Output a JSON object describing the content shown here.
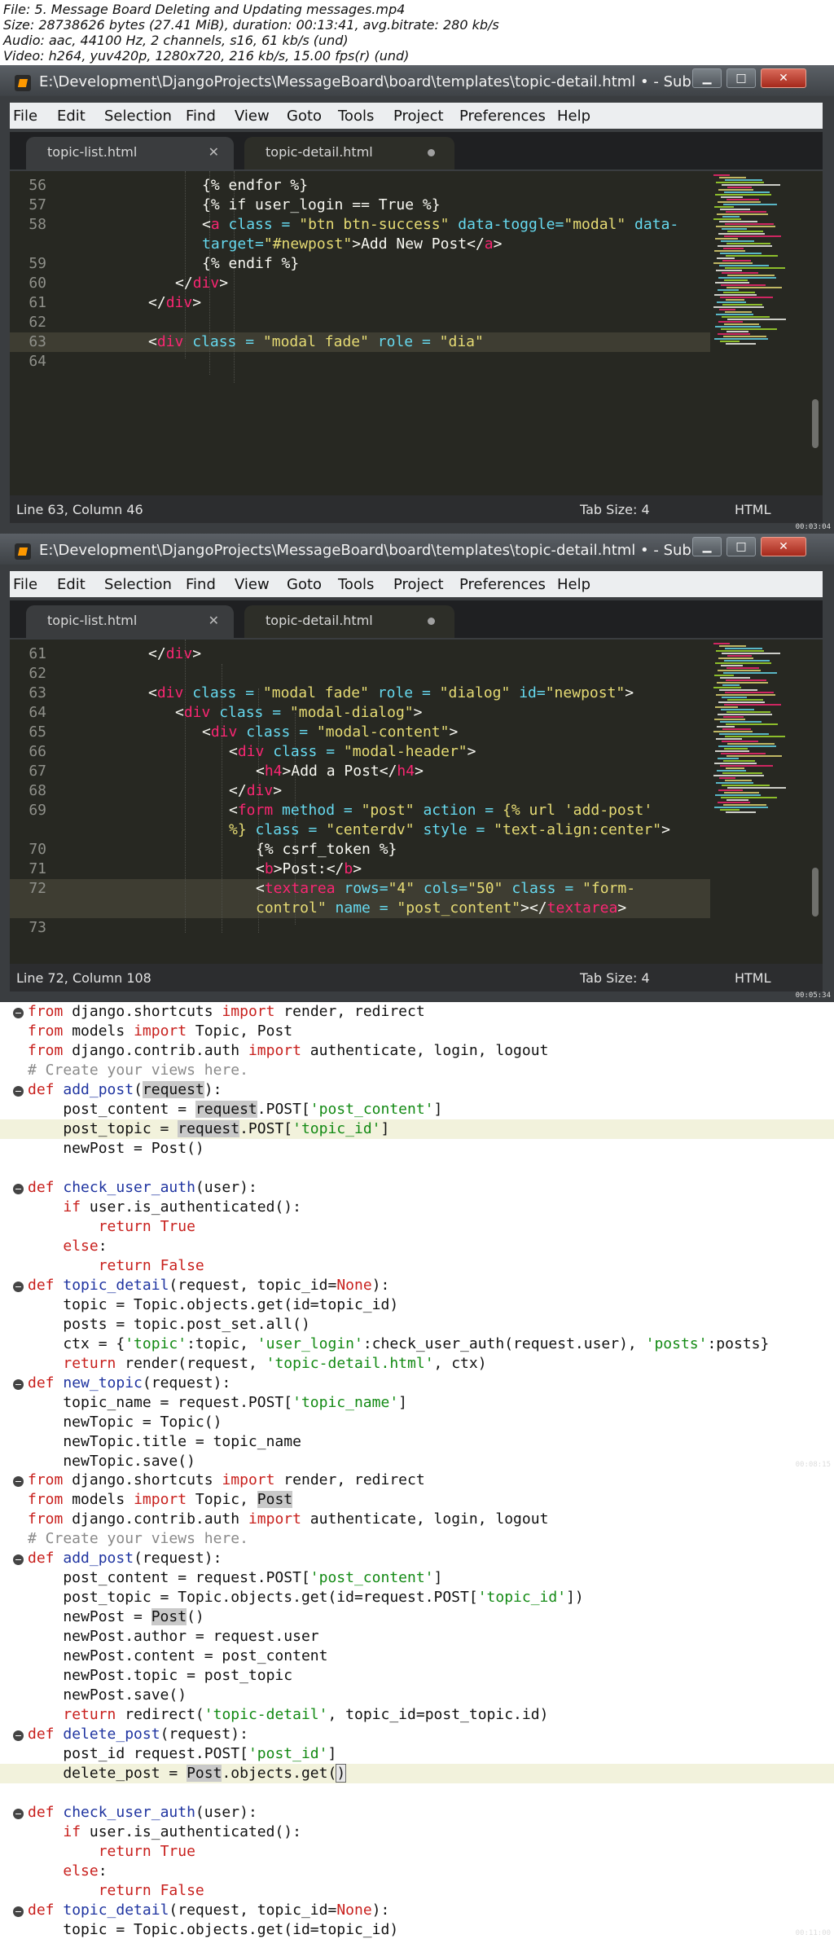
{
  "video_info": [
    "File: 5. Message Board Deleting and Updating messages.mp4",
    "Size: 28738626 bytes (27.41 MiB), duration: 00:13:41, avg.bitrate: 280 kb/s",
    "Audio: aac, 44100 Hz, 2 channels, s16, 61 kb/s (und)",
    "Video: h264, yuv420p, 1280x720, 216 kb/s, 15.00 fps(r) (und)"
  ],
  "colors": {
    "editor_bg": "#272822",
    "keyword": "#f92672",
    "string": "#e6db74",
    "text": "#f8f8f2",
    "py_keyword": "#c8201d",
    "py_function": "#1f34a0",
    "py_string": "#138a14",
    "py_comment": "#8a8a8a"
  },
  "frame1": {
    "title": "E:\\Development\\DjangoProjects\\MessageBoard\\board\\templates\\topic-detail.html • - Subli...",
    "menu": [
      "File",
      "Edit",
      "Selection",
      "Find",
      "View",
      "Goto",
      "Tools",
      "Project",
      "Preferences",
      "Help"
    ],
    "tabs": [
      "topic-list.html",
      "topic-detail.html"
    ],
    "status": {
      "position": "Line 63, Column 46",
      "tab_size": "Tab Size: 4",
      "syntax": "HTML"
    },
    "timestamp": "00:03:04",
    "gutter": [
      "56",
      "57",
      "58",
      "",
      "59",
      "60",
      "61",
      "62",
      "63",
      "64"
    ],
    "lines": [
      [
        [
          "{% endfor %}",
          "text"
        ]
      ],
      [
        [
          "{% if user_login == True %}",
          "text"
        ]
      ],
      [
        [
          "<",
          "text"
        ],
        [
          "a",
          "keyword"
        ],
        [
          " class = ",
          "func"
        ],
        [
          "\"btn btn-success\"",
          "string"
        ],
        [
          " data-toggle=",
          "func"
        ],
        [
          "\"modal\"",
          "string"
        ],
        [
          " data-",
          "func"
        ]
      ],
      [
        [
          "target=",
          "func"
        ],
        [
          "\"#newpost\"",
          "string"
        ],
        [
          ">Add New Post</",
          "text"
        ],
        [
          "a",
          "keyword"
        ],
        [
          ">",
          "text"
        ]
      ],
      [
        [
          "{% endif %}",
          "text"
        ]
      ],
      [
        [
          "</",
          "text"
        ],
        [
          "div",
          "keyword"
        ],
        [
          ">",
          "text"
        ]
      ],
      [
        [
          "</",
          "text"
        ],
        [
          "div",
          "keyword"
        ],
        [
          ">",
          "text"
        ]
      ],
      [
        [
          "",
          "text"
        ]
      ],
      [
        [
          "<",
          "text"
        ],
        [
          "div",
          "keyword"
        ],
        [
          " class = ",
          "func"
        ],
        [
          "\"modal fade\"",
          "string"
        ],
        [
          " role = ",
          "func"
        ],
        [
          "\"dia\"",
          "string"
        ]
      ],
      [
        [
          "",
          "text"
        ]
      ]
    ]
  },
  "frame2": {
    "title": "E:\\Development\\DjangoProjects\\MessageBoard\\board\\templates\\topic-detail.html • - Subli...",
    "menu": [
      "File",
      "Edit",
      "Selection",
      "Find",
      "View",
      "Goto",
      "Tools",
      "Project",
      "Preferences",
      "Help"
    ],
    "tabs": [
      "topic-list.html",
      "topic-detail.html"
    ],
    "status": {
      "position": "Line 72, Column 108",
      "tab_size": "Tab Size: 4",
      "syntax": "HTML"
    },
    "timestamp": "00:05:34",
    "gutter": [
      "61",
      "62",
      "63",
      "64",
      "65",
      "66",
      "67",
      "68",
      "69",
      "",
      "70",
      "71",
      "72",
      "",
      "73"
    ],
    "lines": [
      [
        [
          "</",
          "text"
        ],
        [
          "div",
          "keyword"
        ],
        [
          ">",
          "text"
        ]
      ],
      [
        [
          "",
          "text"
        ]
      ],
      [
        [
          "<",
          "text"
        ],
        [
          "div",
          "keyword"
        ],
        [
          " class = ",
          "func"
        ],
        [
          "\"modal fade\"",
          "string"
        ],
        [
          " role = ",
          "func"
        ],
        [
          "\"dialog\"",
          "string"
        ],
        [
          " id=",
          "func"
        ],
        [
          "\"newpost\"",
          "string"
        ],
        [
          ">",
          "text"
        ]
      ],
      [
        [
          "<",
          "text"
        ],
        [
          "div",
          "keyword"
        ],
        [
          " class = ",
          "func"
        ],
        [
          "\"modal-dialog\"",
          "string"
        ],
        [
          ">",
          "text"
        ]
      ],
      [
        [
          "<",
          "text"
        ],
        [
          "div",
          "keyword"
        ],
        [
          " class = ",
          "func"
        ],
        [
          "\"modal-content\"",
          "string"
        ],
        [
          ">",
          "text"
        ]
      ],
      [
        [
          "<",
          "text"
        ],
        [
          "div",
          "keyword"
        ],
        [
          " class = ",
          "func"
        ],
        [
          "\"modal-header\"",
          "string"
        ],
        [
          ">",
          "text"
        ]
      ],
      [
        [
          "<",
          "text"
        ],
        [
          "h4",
          "keyword"
        ],
        [
          ">Add a Post</",
          "text"
        ],
        [
          "h4",
          "keyword"
        ],
        [
          ">",
          "text"
        ]
      ],
      [
        [
          "</",
          "text"
        ],
        [
          "div",
          "keyword"
        ],
        [
          ">",
          "text"
        ]
      ],
      [
        [
          "<",
          "text"
        ],
        [
          "form",
          "keyword"
        ],
        [
          " method = ",
          "func"
        ],
        [
          "\"post\"",
          "string"
        ],
        [
          " action = ",
          "func"
        ],
        [
          "{% url 'add-post'",
          "string"
        ]
      ],
      [
        [
          "%}",
          "string"
        ],
        [
          " class = ",
          "func"
        ],
        [
          "\"centerdv\"",
          "string"
        ],
        [
          " style = ",
          "func"
        ],
        [
          "\"text-align:center\"",
          "string"
        ],
        [
          ">",
          "text"
        ]
      ],
      [
        [
          "{% csrf_token %}",
          "text"
        ]
      ],
      [
        [
          "<",
          "text"
        ],
        [
          "b",
          "keyword"
        ],
        [
          ">Post:</",
          "text"
        ],
        [
          "b",
          "keyword"
        ],
        [
          ">",
          "text"
        ]
      ],
      [
        [
          "<",
          "text"
        ],
        [
          "textarea",
          "keyword"
        ],
        [
          " rows=",
          "func"
        ],
        [
          "\"4\"",
          "string"
        ],
        [
          " cols=",
          "func"
        ],
        [
          "\"50\"",
          "string"
        ],
        [
          " class = ",
          "func"
        ],
        [
          "\"form-",
          "string"
        ]
      ],
      [
        [
          "control\"",
          "string"
        ],
        [
          " name = ",
          "func"
        ],
        [
          "\"post_content\"",
          "string"
        ],
        [
          "></",
          "text"
        ],
        [
          "textarea",
          "keyword"
        ],
        [
          ">",
          "text"
        ]
      ],
      [
        [
          "",
          "text"
        ]
      ]
    ]
  },
  "frame3": {
    "timestamp": "00:08:15",
    "lines": [
      [
        [
          "from",
          "kw"
        ],
        [
          " django.shortcuts ",
          "txt"
        ],
        [
          "import",
          "kw"
        ],
        [
          " render, redirect",
          "txt"
        ]
      ],
      [
        [
          "from",
          "kw"
        ],
        [
          " models ",
          "txt"
        ],
        [
          "import",
          "kw"
        ],
        [
          " Topic, Post",
          "txt"
        ]
      ],
      [
        [
          "from",
          "kw"
        ],
        [
          " django.contrib.auth ",
          "txt"
        ],
        [
          "import",
          "kw"
        ],
        [
          " authenticate, login, logout",
          "txt"
        ]
      ],
      [
        [
          "# Create your views here.",
          "cm"
        ]
      ],
      [
        [
          "def",
          "kw"
        ],
        [
          " ",
          "txt"
        ],
        [
          "add_post",
          "fn"
        ],
        [
          "(",
          "txt"
        ],
        [
          "request",
          "sel"
        ],
        [
          "):",
          "txt"
        ]
      ],
      [
        [
          "    post_content = ",
          "txt"
        ],
        [
          "request",
          "sel"
        ],
        [
          ".POST[",
          "txt"
        ],
        [
          "'post_content'",
          "str"
        ],
        [
          "]",
          "txt"
        ]
      ],
      [
        [
          "    post_topic = ",
          "txt"
        ],
        [
          "request",
          "sel"
        ],
        [
          ".POST[",
          "txt"
        ],
        [
          "'topic_id'",
          "str"
        ],
        [
          "]",
          "txt"
        ]
      ],
      [
        [
          "    newPost = Post()",
          "txt"
        ]
      ],
      [
        [
          "",
          "txt"
        ]
      ],
      [
        [
          "def",
          "kw"
        ],
        [
          " ",
          "txt"
        ],
        [
          "check_user_auth",
          "fn"
        ],
        [
          "(user):",
          "txt"
        ]
      ],
      [
        [
          "    ",
          "txt"
        ],
        [
          "if",
          "kw"
        ],
        [
          " user.is_authenticated():",
          "txt"
        ]
      ],
      [
        [
          "        ",
          "txt"
        ],
        [
          "return",
          "kw"
        ],
        [
          " ",
          "txt"
        ],
        [
          "True",
          "kw"
        ]
      ],
      [
        [
          "    ",
          "txt"
        ],
        [
          "else",
          "kw"
        ],
        [
          ":",
          "txt"
        ]
      ],
      [
        [
          "        ",
          "txt"
        ],
        [
          "return",
          "kw"
        ],
        [
          " ",
          "txt"
        ],
        [
          "False",
          "kw"
        ]
      ],
      [
        [
          "def",
          "kw"
        ],
        [
          " ",
          "txt"
        ],
        [
          "topic_detail",
          "fn"
        ],
        [
          "(request, topic_id=",
          "txt"
        ],
        [
          "None",
          "kw"
        ],
        [
          "):",
          "txt"
        ]
      ],
      [
        [
          "    topic = Topic.objects.get(id=topic_id)",
          "txt"
        ]
      ],
      [
        [
          "    posts = topic.post_set.all()",
          "txt"
        ]
      ],
      [
        [
          "    ctx = {",
          "txt"
        ],
        [
          "'topic'",
          "str"
        ],
        [
          ":topic, ",
          "txt"
        ],
        [
          "'user_login'",
          "str"
        ],
        [
          ":check_user_auth(request.user), ",
          "txt"
        ],
        [
          "'posts'",
          "str"
        ],
        [
          ":posts}",
          "txt"
        ]
      ],
      [
        [
          "    ",
          "txt"
        ],
        [
          "return",
          "kw"
        ],
        [
          " render(request, ",
          "txt"
        ],
        [
          "'topic-detail.html'",
          "str"
        ],
        [
          ", ctx)",
          "txt"
        ]
      ],
      [
        [
          "def",
          "kw"
        ],
        [
          " ",
          "txt"
        ],
        [
          "new_topic",
          "fn"
        ],
        [
          "(request):",
          "txt"
        ]
      ],
      [
        [
          "    topic_name = request.POST[",
          "txt"
        ],
        [
          "'topic_name'",
          "str"
        ],
        [
          "]",
          "txt"
        ]
      ],
      [
        [
          "    newTopic = Topic()",
          "txt"
        ]
      ],
      [
        [
          "    newTopic.title = topic_name",
          "txt"
        ]
      ],
      [
        [
          "    newTopic.save()",
          "txt"
        ]
      ]
    ]
  },
  "frame4": {
    "timestamp": "00:11:00",
    "lines": [
      [
        [
          "from",
          "kw"
        ],
        [
          " django.shortcuts ",
          "txt"
        ],
        [
          "import",
          "kw"
        ],
        [
          " render, redirect",
          "txt"
        ]
      ],
      [
        [
          "from",
          "kw"
        ],
        [
          " models ",
          "txt"
        ],
        [
          "import",
          "kw"
        ],
        [
          " Topic, ",
          "txt"
        ],
        [
          "Post",
          "sel"
        ]
      ],
      [
        [
          "from",
          "kw"
        ],
        [
          " django.contrib.auth ",
          "txt"
        ],
        [
          "import",
          "kw"
        ],
        [
          " authenticate, login, logout",
          "txt"
        ]
      ],
      [
        [
          "# Create your views here.",
          "cm"
        ]
      ],
      [
        [
          "def",
          "kw"
        ],
        [
          " ",
          "txt"
        ],
        [
          "add_post",
          "fn"
        ],
        [
          "(request):",
          "txt"
        ]
      ],
      [
        [
          "    post_content = request.POST[",
          "txt"
        ],
        [
          "'post_content'",
          "str"
        ],
        [
          "]",
          "txt"
        ]
      ],
      [
        [
          "    post_topic = Topic.objects.get(id=request.POST[",
          "txt"
        ],
        [
          "'topic_id'",
          "str"
        ],
        [
          "])",
          "txt"
        ]
      ],
      [
        [
          "    newPost = ",
          "txt"
        ],
        [
          "Post",
          "sel"
        ],
        [
          "()",
          "txt"
        ]
      ],
      [
        [
          "    newPost.author = request.user",
          "txt"
        ]
      ],
      [
        [
          "    newPost.content = post_content",
          "txt"
        ]
      ],
      [
        [
          "    newPost.topic = post_topic",
          "txt"
        ]
      ],
      [
        [
          "    newPost.save()",
          "txt"
        ]
      ],
      [
        [
          "    ",
          "txt"
        ],
        [
          "return",
          "kw"
        ],
        [
          " redirect(",
          "txt"
        ],
        [
          "'topic-detail'",
          "str"
        ],
        [
          ", topic_id=post_topic.id)",
          "txt"
        ]
      ],
      [
        [
          "def",
          "kw"
        ],
        [
          " ",
          "txt"
        ],
        [
          "delete_post",
          "fn"
        ],
        [
          "(request):",
          "txt"
        ]
      ],
      [
        [
          "    post_id request.POST[",
          "txt"
        ],
        [
          "'post_id'",
          "str"
        ],
        [
          "]",
          "txt"
        ]
      ],
      [
        [
          "    delete_post = ",
          "txt"
        ],
        [
          "Post",
          "sel"
        ],
        [
          ".objects.get(",
          "txt"
        ],
        [
          ")",
          "cur"
        ]
      ],
      [
        [
          "",
          "txt"
        ]
      ],
      [
        [
          "def",
          "kw"
        ],
        [
          " ",
          "txt"
        ],
        [
          "check_user_auth",
          "fn"
        ],
        [
          "(user):",
          "txt"
        ]
      ],
      [
        [
          "    ",
          "txt"
        ],
        [
          "if",
          "kw"
        ],
        [
          " user.is_authenticated():",
          "txt"
        ]
      ],
      [
        [
          "        ",
          "txt"
        ],
        [
          "return",
          "kw"
        ],
        [
          " ",
          "txt"
        ],
        [
          "True",
          "kw"
        ]
      ],
      [
        [
          "    ",
          "txt"
        ],
        [
          "else",
          "kw"
        ],
        [
          ":",
          "txt"
        ]
      ],
      [
        [
          "        ",
          "txt"
        ],
        [
          "return",
          "kw"
        ],
        [
          " ",
          "txt"
        ],
        [
          "False",
          "kw"
        ]
      ],
      [
        [
          "def",
          "kw"
        ],
        [
          " ",
          "txt"
        ],
        [
          "topic_detail",
          "fn"
        ],
        [
          "(request, topic_id=",
          "txt"
        ],
        [
          "None",
          "kw"
        ],
        [
          "):",
          "txt"
        ]
      ],
      [
        [
          "    topic = Topic.objects.get(id=topic_id)",
          "txt"
        ]
      ]
    ]
  }
}
